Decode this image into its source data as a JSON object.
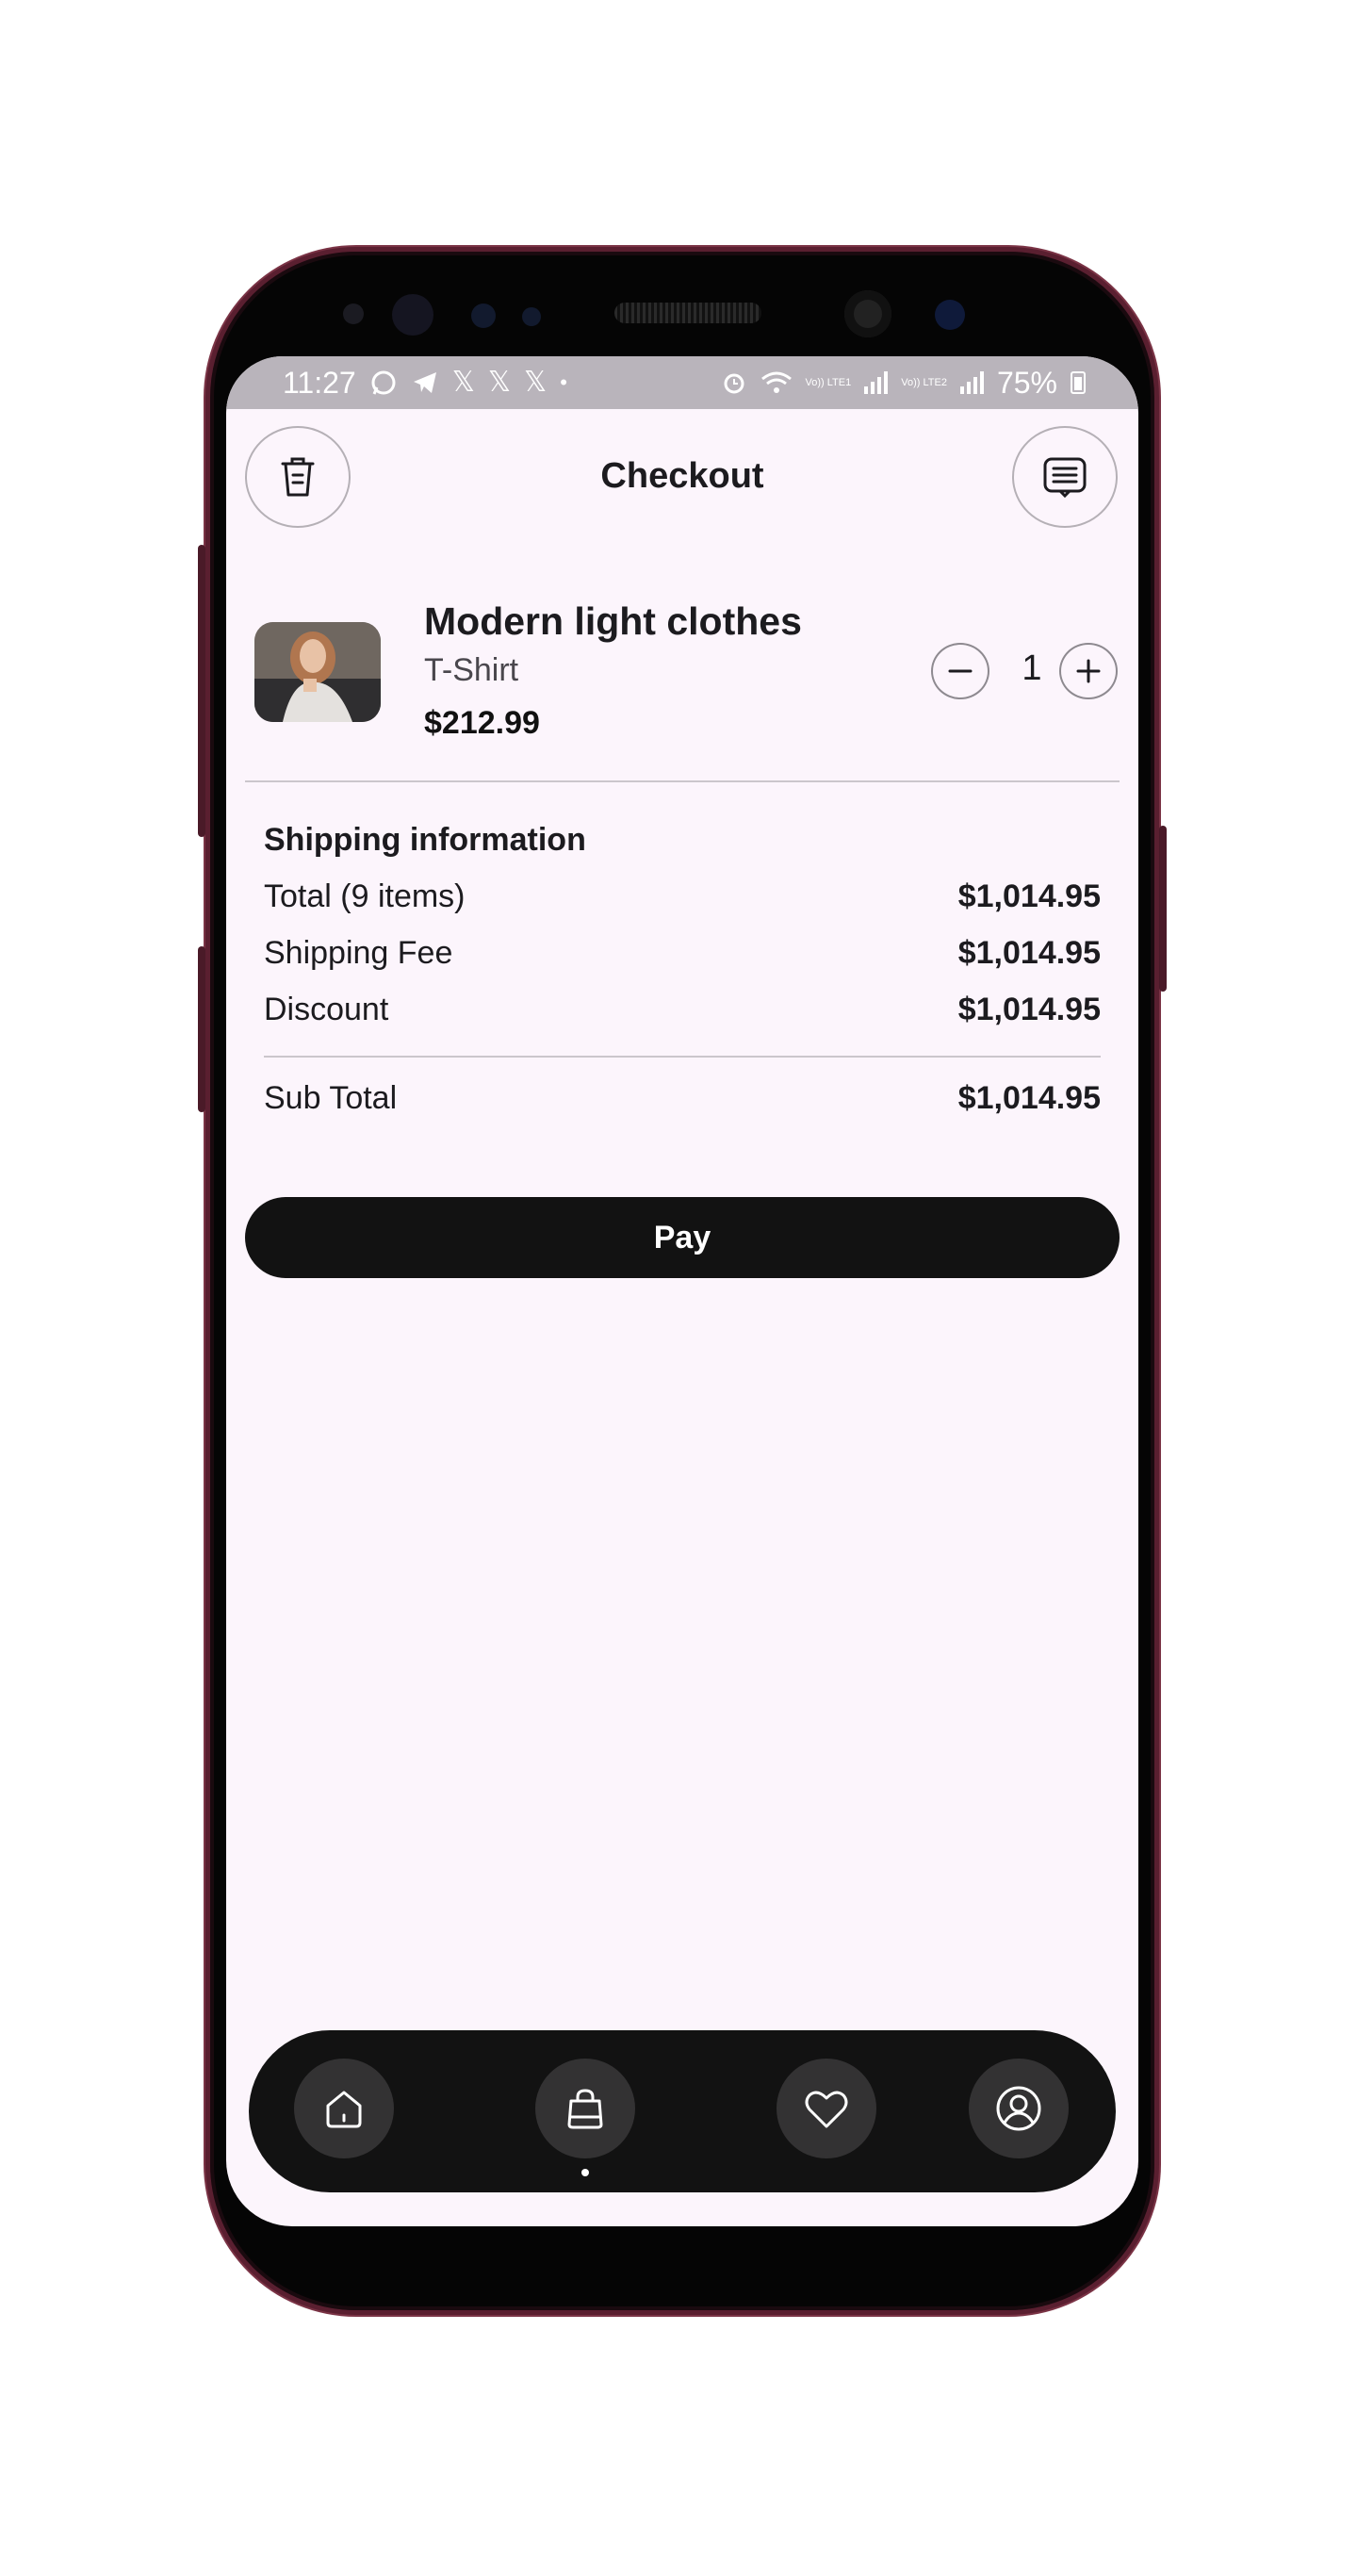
{
  "status_bar": {
    "time": "11:27",
    "left_icons": [
      "whatsapp-icon",
      "telegram-icon",
      "x-icon",
      "x-icon",
      "x-icon",
      "dot"
    ],
    "right_icons": [
      "alarm-icon",
      "wifi-icon",
      "signal-icon",
      "signal-icon"
    ],
    "sim1_label": "Vo)) LTE1",
    "sim2_label": "Vo)) LTE2",
    "battery": "75%"
  },
  "header": {
    "title": "Checkout",
    "left_icon": "trash-icon",
    "right_icon": "receipt-icon"
  },
  "cart_item": {
    "name": "Modern light clothes",
    "type": "T-Shirt",
    "price": "$212.99",
    "quantity": "1"
  },
  "shipping": {
    "title": "Shipping information",
    "rows": [
      {
        "label": "Total (9 items)",
        "value": "$1,014.95"
      },
      {
        "label": "Shipping Fee",
        "value": "$1,014.95"
      },
      {
        "label": "Discount",
        "value": "$1,014.95"
      }
    ],
    "subtotal": {
      "label": "Sub Total",
      "value": "$1,014.95"
    }
  },
  "pay_button": {
    "label": "Pay"
  },
  "bottom_nav": {
    "items": [
      {
        "icon": "home-icon"
      },
      {
        "icon": "shopping-bag-icon",
        "active": true
      },
      {
        "icon": "heart-icon"
      },
      {
        "icon": "profile-icon"
      }
    ]
  },
  "colors": {
    "background": "#fcf5fc",
    "button": "#121212",
    "phone_frame": "#5a1f30"
  }
}
